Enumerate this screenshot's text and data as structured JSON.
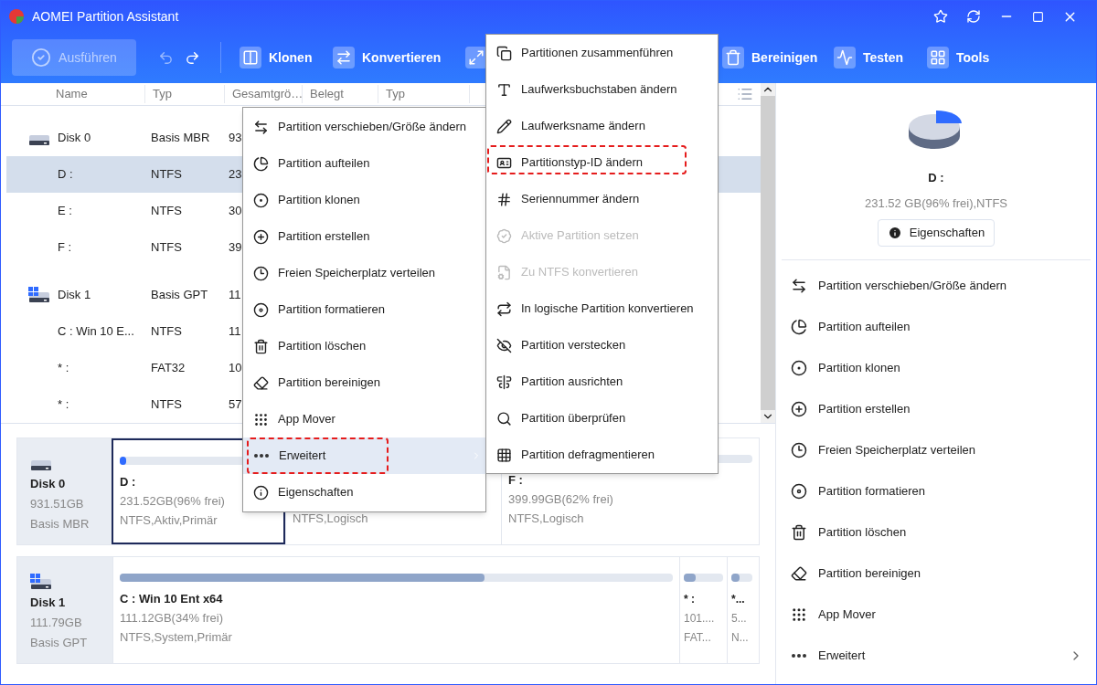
{
  "window": {
    "title": "AOMEI Partition Assistant"
  },
  "toolbar": {
    "apply": {
      "label": "Ausführen",
      "disabled": true
    },
    "undo_disabled": true,
    "items": [
      {
        "kind": "clone",
        "label": "Klonen"
      },
      {
        "kind": "convert",
        "label": "Konvertieren"
      },
      {
        "kind": "resize"
      },
      {
        "kind": "wipe",
        "label": "Bereinigen"
      },
      {
        "kind": "test",
        "label": "Testen"
      },
      {
        "kind": "tools",
        "label": "Tools"
      }
    ]
  },
  "table": {
    "columns": [
      "Name",
      "Typ",
      "Gesamtgrö…",
      "Belegt",
      "Typ"
    ],
    "rows": [
      {
        "kind": "mbr_disk",
        "name": "Disk 0",
        "type": "Basis MBR",
        "total": "93",
        "selected": false
      },
      {
        "kind": "partition",
        "name": "D :",
        "type": "NTFS",
        "total": "23",
        "selected": true
      },
      {
        "kind": "partition",
        "name": "E :",
        "type": "NTFS",
        "total": "30",
        "selected": false
      },
      {
        "kind": "partition",
        "name": "F :",
        "type": "NTFS",
        "total": "39",
        "selected": false
      },
      {
        "kind": "gpt_disk",
        "name": "Disk 1",
        "type": "Basis GPT",
        "total": "11",
        "selected": false
      },
      {
        "kind": "partition",
        "name": "C : Win 10 E...",
        "type": "NTFS",
        "total": "11",
        "selected": false
      },
      {
        "kind": "partition",
        "name": "* :",
        "type": "FAT32",
        "total": "10",
        "selected": false
      },
      {
        "kind": "partition",
        "name": "* :",
        "type": "NTFS",
        "total": "57",
        "selected": false
      }
    ]
  },
  "disk_map": [
    {
      "kind": "mbr",
      "name": "Disk 0",
      "size": "931.51GB",
      "type": "Basis MBR",
      "partitions": [
        {
          "name": "D :",
          "free": "231.52GB(96% frei)",
          "info": "NTFS,Aktiv,Primär",
          "level": 0.04,
          "selected": true
        },
        {
          "info": "NTFS,Logisch",
          "selected": false
        },
        {
          "name": "F :",
          "free": "399.99GB(62% frei)",
          "info": "NTFS,Logisch",
          "selected": false
        }
      ]
    },
    {
      "kind": "gpt",
      "name": "Disk 1",
      "size": "111.79GB",
      "type": "Basis GPT",
      "partitions": [
        {
          "name": "C : Win 10 Ent x64",
          "free": "111.12GB(34% frei)",
          "info": "NTFS,System,Primär",
          "level": 0.66,
          "selected": false
        },
        {
          "name": "* :",
          "free": "101....",
          "info": "FAT...",
          "level": 0.3,
          "selected": false
        },
        {
          "name": "*...",
          "free": "5...",
          "info": "N...",
          "level": 0.4,
          "selected": false
        }
      ]
    }
  ],
  "details": {
    "title": "D :",
    "info": "231.52 GB(96% frei),NTFS",
    "button": "Eigenschaften",
    "operations": [
      {
        "label": "Partition verschieben/Größe ändern",
        "has_submenu": false
      },
      {
        "label": "Partition aufteilen",
        "has_submenu": false
      },
      {
        "label": "Partition klonen",
        "has_submenu": false
      },
      {
        "label": "Partition erstellen",
        "has_submenu": false
      },
      {
        "label": "Freien Speicherplatz verteilen",
        "has_submenu": false
      },
      {
        "label": "Partition formatieren",
        "has_submenu": false
      },
      {
        "label": "Partition löschen",
        "has_submenu": false
      },
      {
        "label": "Partition bereinigen",
        "has_submenu": false
      },
      {
        "label": "App Mover",
        "has_submenu": false
      },
      {
        "label": "Erweitert",
        "has_submenu": true
      }
    ]
  },
  "context_menu": {
    "items": [
      {
        "label": "Partition verschieben/Größe ändern",
        "highlighted": false,
        "annotated": false,
        "has_submenu": false
      },
      {
        "label": "Partition aufteilen",
        "highlighted": false,
        "annotated": false,
        "has_submenu": false
      },
      {
        "label": "Partition klonen",
        "highlighted": false,
        "annotated": false,
        "has_submenu": false
      },
      {
        "label": "Partition erstellen",
        "highlighted": false,
        "annotated": false,
        "has_submenu": false
      },
      {
        "label": "Freien Speicherplatz verteilen",
        "highlighted": false,
        "annotated": false,
        "has_submenu": false
      },
      {
        "label": "Partition formatieren",
        "highlighted": false,
        "annotated": false,
        "has_submenu": false
      },
      {
        "label": "Partition löschen",
        "highlighted": false,
        "annotated": false,
        "has_submenu": false
      },
      {
        "label": "Partition bereinigen",
        "highlighted": false,
        "annotated": false,
        "has_submenu": false
      },
      {
        "label": "App Mover",
        "highlighted": false,
        "annotated": false,
        "has_submenu": false
      },
      {
        "label": "Erweitert",
        "highlighted": true,
        "annotated": true,
        "has_submenu": true
      },
      {
        "label": "Eigenschaften",
        "highlighted": false,
        "annotated": false,
        "has_submenu": false
      }
    ]
  },
  "submenu": {
    "items": [
      {
        "label": "Partitionen zusammenführen",
        "disabled": false,
        "annotated": false
      },
      {
        "label": "Laufwerksbuchstaben ändern",
        "disabled": false,
        "annotated": false
      },
      {
        "label": "Laufwerksname ändern",
        "disabled": false,
        "annotated": false
      },
      {
        "label": "Partitionstyp-ID ändern",
        "disabled": false,
        "annotated": true
      },
      {
        "label": "Seriennummer ändern",
        "disabled": false,
        "annotated": false
      },
      {
        "label": "Aktive Partition setzen",
        "disabled": true,
        "annotated": false
      },
      {
        "label": "Zu NTFS konvertieren",
        "disabled": true,
        "annotated": false
      },
      {
        "label": "In logische Partition konvertieren",
        "disabled": false,
        "annotated": false
      },
      {
        "label": "Partition verstecken",
        "disabled": false,
        "annotated": false
      },
      {
        "label": "Partition ausrichten",
        "disabled": false,
        "annotated": false
      },
      {
        "label": "Partition überprüfen",
        "disabled": false,
        "annotated": false
      },
      {
        "label": "Partition defragmentieren",
        "disabled": false,
        "annotated": false
      }
    ]
  }
}
